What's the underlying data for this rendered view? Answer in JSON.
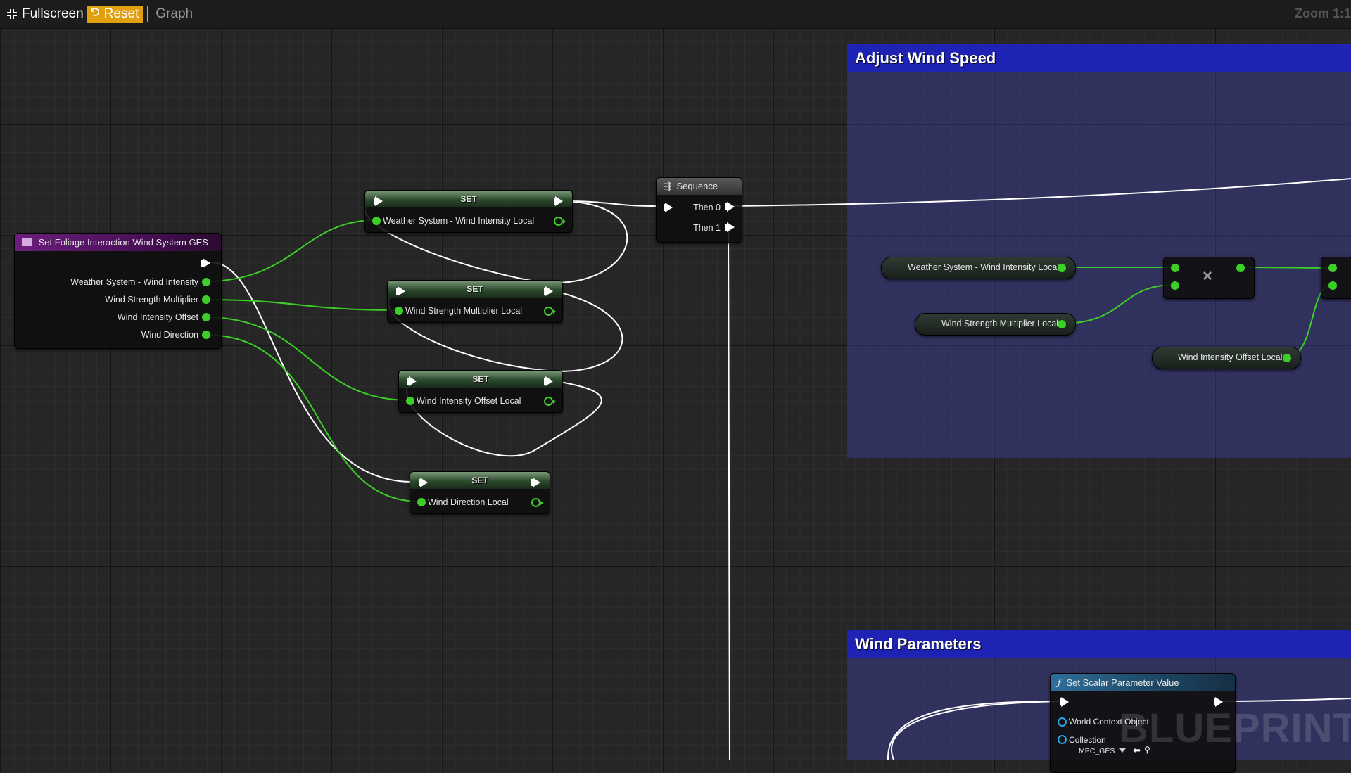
{
  "toolbar": {
    "fullscreen": "Fullscreen",
    "reset": "Reset",
    "graph": "Graph",
    "zoom": "Zoom 1:1"
  },
  "comments": {
    "adjust": "Adjust Wind Speed",
    "wind_params": "Wind Parameters"
  },
  "event_node": {
    "title": "Set Foliage Interaction Wind System GES",
    "pins": [
      "Weather System - Wind Intensity",
      "Wind Strength Multiplier",
      "Wind Intensity Offset",
      "Wind Direction"
    ]
  },
  "set_nodes": [
    {
      "title": "SET",
      "pin": "Weather System - Wind Intensity Local"
    },
    {
      "title": "SET",
      "pin": "Wind Strength Multiplier Local"
    },
    {
      "title": "SET",
      "pin": "Wind Intensity Offset Local"
    },
    {
      "title": "SET",
      "pin": "Wind Direction Local"
    }
  ],
  "sequence": {
    "title": "Sequence",
    "then0": "Then 0",
    "then1": "Then 1"
  },
  "getters": {
    "wind_intensity": "Weather System - Wind Intensity Local",
    "strength_mult": "Wind Strength Multiplier Local",
    "intensity_offset": "Wind Intensity Offset Local"
  },
  "multiply": {
    "symbol": "×"
  },
  "scalar_node": {
    "title": "Set Scalar Parameter Value",
    "pins": [
      "World Context Object",
      "Collection"
    ],
    "collection_value": "MPC_GES"
  },
  "watermark": "BLUEPRINT",
  "colors": {
    "exec_wire": "#ffffff",
    "float_wire": "#3ccf27",
    "comment_header": "#1e23b4",
    "reset_bg": "#e0a010"
  }
}
